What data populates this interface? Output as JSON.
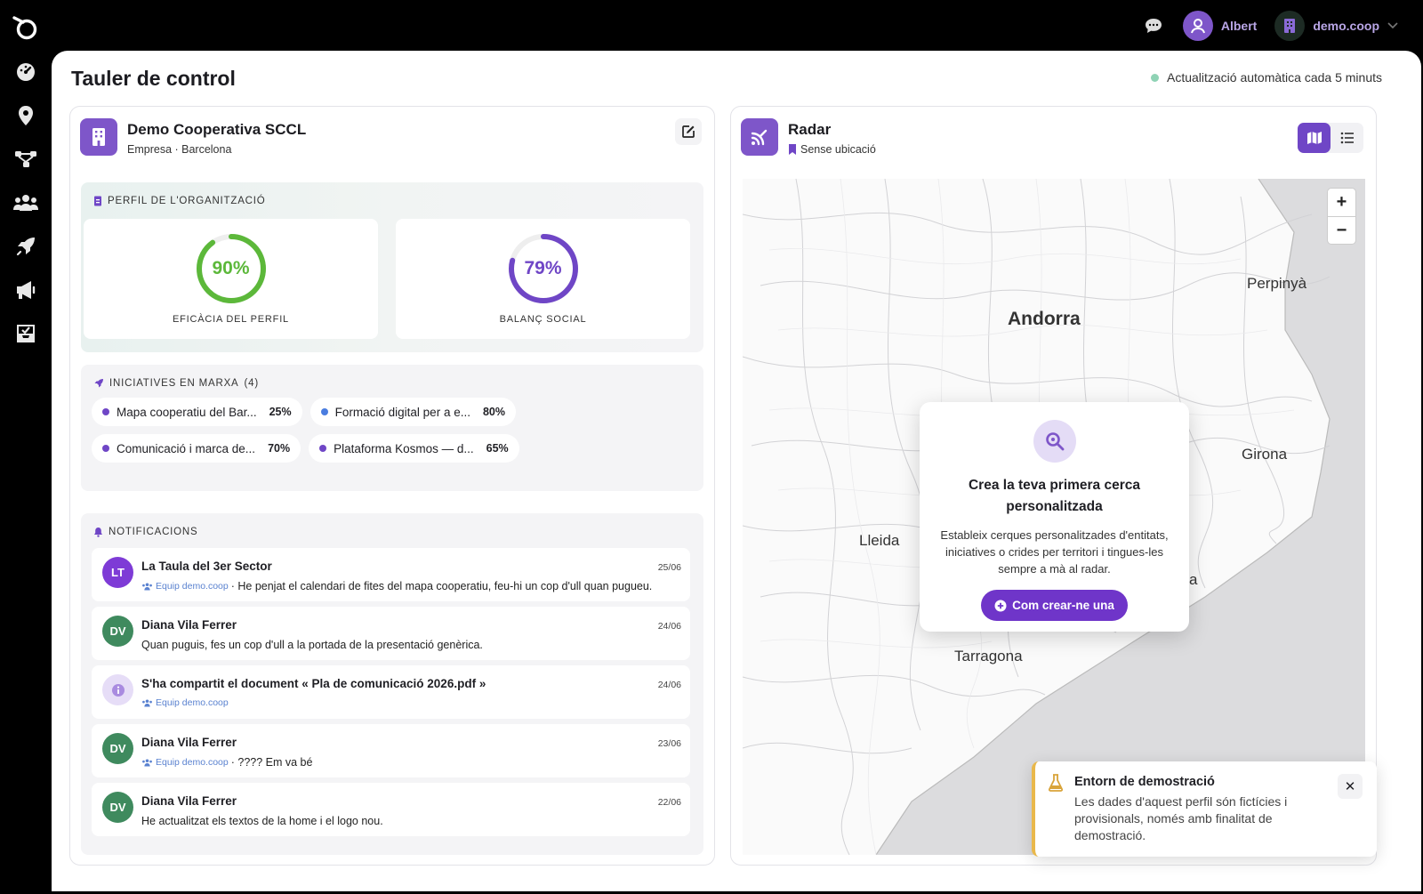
{
  "topbar": {
    "user_name": "Albert",
    "org_name": "demo.coop"
  },
  "sidebar": {
    "items": [
      "dashboard-icon",
      "map-pin-icon",
      "network-icon",
      "users-icon",
      "rocket-icon",
      "megaphone-icon",
      "inbox-icon"
    ]
  },
  "page": {
    "title": "Tauler de control",
    "auto_update": "Actualització automàtica cada 5 minuts"
  },
  "org_card": {
    "name": "Demo Cooperativa SCCL",
    "subtitle": "Empresa · Barcelona",
    "profile_section": "Perfil de l'organització",
    "gauges": [
      {
        "value": 90,
        "display": "90%",
        "label": "Eficàcia del perfil",
        "color": "#5cb83a"
      },
      {
        "value": 79,
        "display": "79%",
        "label": "Balanç social",
        "color": "#6f46c6"
      }
    ],
    "initiatives_section": "Iniciatives en marxa",
    "initiatives_count": "(4)",
    "initiatives": [
      {
        "name": "Mapa cooperatiu del Bar...",
        "pct": "25%",
        "color": "#6f46c6"
      },
      {
        "name": "Formació digital per a e...",
        "pct": "80%",
        "color": "#4a7de0"
      },
      {
        "name": "Comunicació i marca de...",
        "pct": "70%",
        "color": "#6f46c6"
      },
      {
        "name": "Plataforma Kosmos — d...",
        "pct": "65%",
        "color": "#6f46c6"
      }
    ],
    "notifications_section": "Notificacions",
    "notifications": [
      {
        "initials": "LT",
        "avatar_color": "#7e3bd6",
        "title": "La Taula del 3er Sector",
        "date": "25/06",
        "team": "Equip demo.coop",
        "text": "· He penjat el calendari de fites del mapa cooperatiu, feu-hi un cop d'ull quan pugueu."
      },
      {
        "initials": "DV",
        "avatar_color": "#3f8a5e",
        "title": "Diana Vila Ferrer",
        "date": "24/06",
        "team": "",
        "text": "Quan puguis, fes un cop d'ull a la portada de la presentació genèrica."
      },
      {
        "initials": "i",
        "avatar_color": "#e6ddf7",
        "title": "S'ha compartit el document « Pla de comunicació 2026.pdf »",
        "date": "24/06",
        "team": "Equip demo.coop",
        "text": ""
      },
      {
        "initials": "DV",
        "avatar_color": "#3f8a5e",
        "title": "Diana Vila Ferrer",
        "date": "23/06",
        "team": "Equip demo.coop",
        "text": "· ???? Em va bé"
      },
      {
        "initials": "DV",
        "avatar_color": "#3f8a5e",
        "title": "Diana Vila Ferrer",
        "date": "22/06",
        "team": "",
        "text": "He actualitzat els textos de la home i el logo nou."
      }
    ]
  },
  "radar_card": {
    "title": "Radar",
    "subtitle": "Sense ubicació",
    "zoom_in": "+",
    "zoom_out": "−",
    "cities": [
      "Perpinyà",
      "Andorra",
      "Girona",
      "Lleida",
      "Tarragona",
      "a"
    ],
    "modal": {
      "title": "Crea la teva primera cerca personalitzada",
      "text": "Estableix cerques personalitzades d'entitats, iniciatives o crides per territori i tingues-les sempre a mà al radar.",
      "cta": "Com crear-ne una"
    }
  },
  "toast": {
    "title": "Entorn de demostració",
    "text": "Les dades d'aquest perfil són fictícies i provisionals, només amb finalitat de demostració.",
    "close": "✕"
  }
}
